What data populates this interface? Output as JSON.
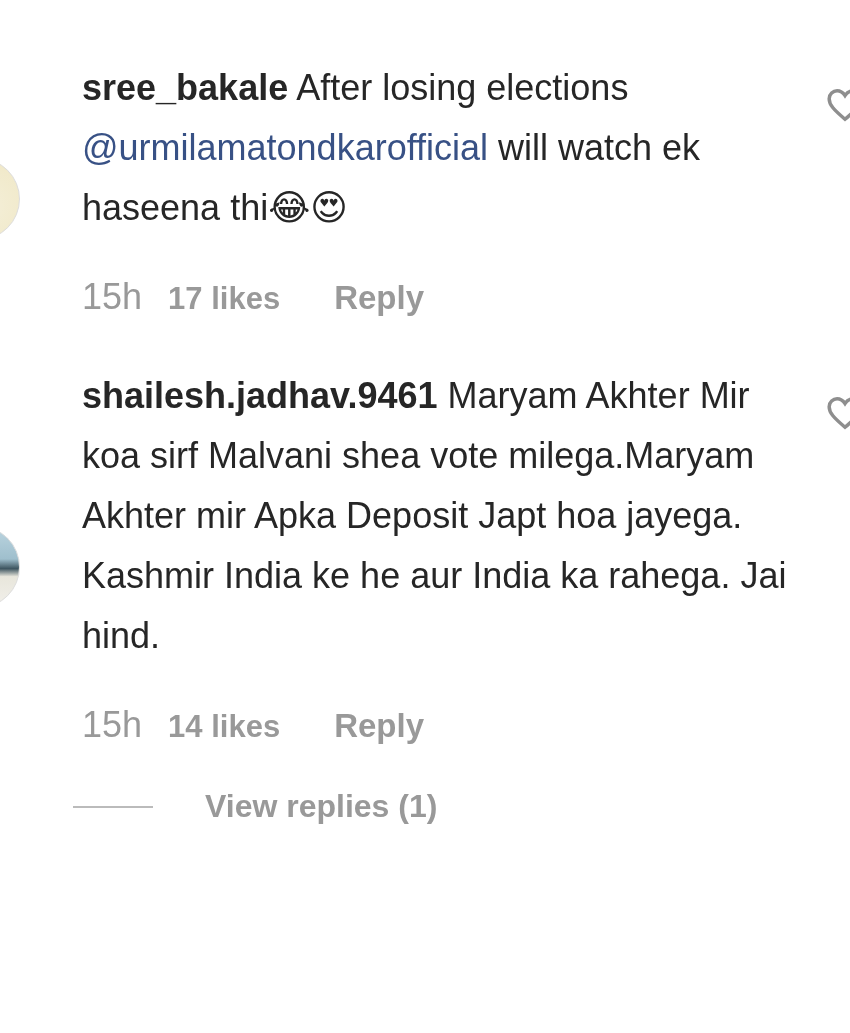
{
  "comments": [
    {
      "username": "sree_bakale",
      "parts": [
        {
          "kind": "text",
          "text": "After losing elections"
        },
        {
          "kind": "mention",
          "text": "@urmilamatondkarofficial"
        },
        {
          "kind": "text",
          "text": "will watch ek haseena thi😂😍"
        }
      ],
      "time": "15h",
      "likes": "17 likes",
      "reply": "Reply",
      "liked": false
    },
    {
      "username": "shailesh.jadhav.9461",
      "parts": [
        {
          "kind": "text",
          "text": "Maryam Akhter Mir koa sirf Malvani shea vote milega.Maryam Akhter mir Apka Deposit Japt hoa jayega. Kashmir India ke he aur India ka rahega. Jai hind."
        }
      ],
      "time": "15h",
      "likes": "14 likes",
      "reply": "Reply",
      "liked": false,
      "view_replies": "View replies (1)"
    }
  ]
}
